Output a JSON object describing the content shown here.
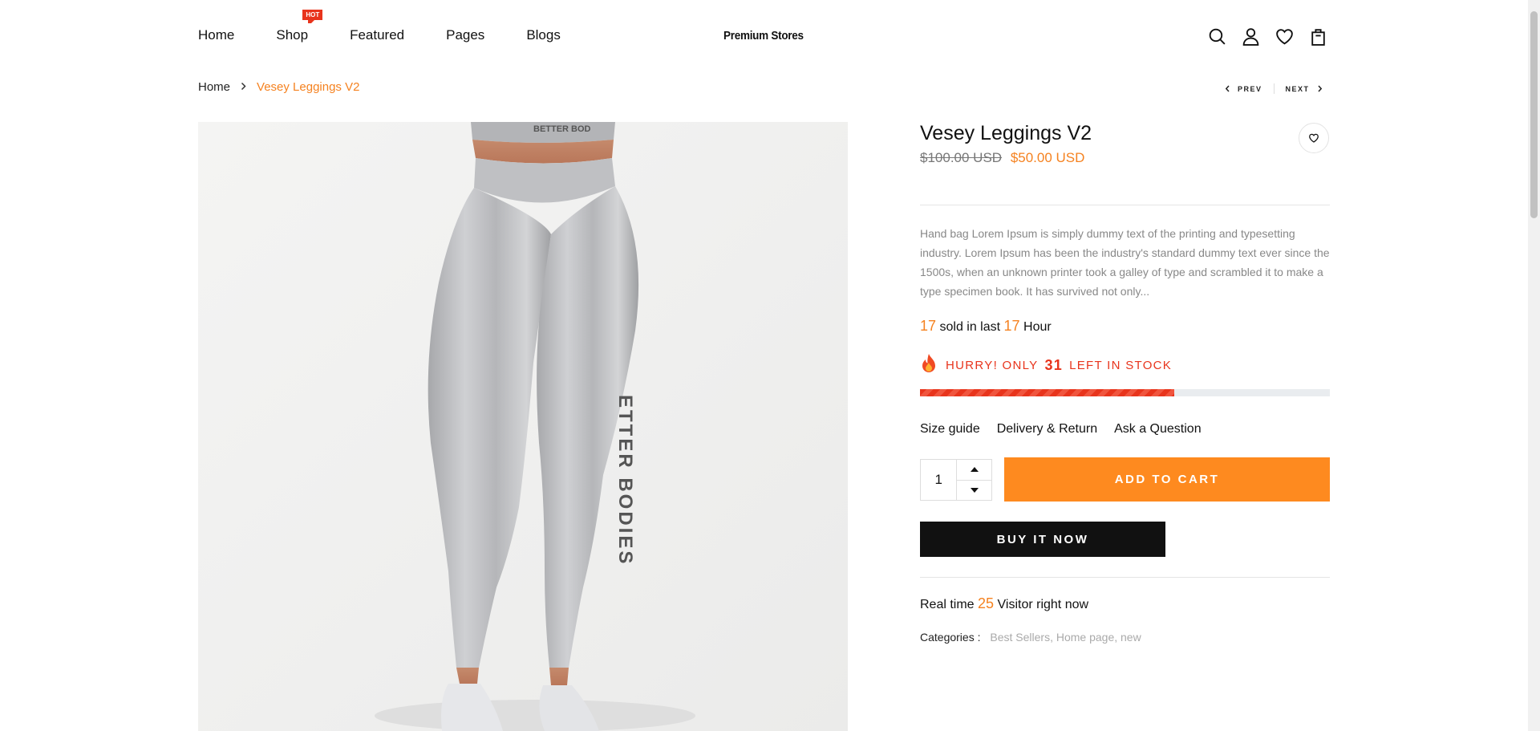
{
  "header": {
    "nav": [
      {
        "label": "Home"
      },
      {
        "label": "Shop",
        "badge": "HOT"
      },
      {
        "label": "Featured"
      },
      {
        "label": "Pages"
      },
      {
        "label": "Blogs"
      }
    ],
    "logo": "Premium Stores",
    "icons": [
      "search-icon",
      "user-icon",
      "heart-icon",
      "bag-icon"
    ]
  },
  "breadcrumb": {
    "home": "Home",
    "current": "Vesey Leggings V2"
  },
  "pager": {
    "prev": "PREV",
    "next": "NEXT"
  },
  "product": {
    "title": "Vesey Leggings V2",
    "old_price": "$100.00 USD",
    "price": "$50.00 USD",
    "description": "Hand bag Lorem Ipsum is simply dummy text of the printing and typesetting industry. Lorem Ipsum has been the industry's standard dummy text ever since the 1500s, when an unknown printer took a galley of type and scrambled it to make a type specimen book. It has survived not only...",
    "sold": {
      "count": "17",
      "text1": "sold in last",
      "hours": "17",
      "text2": "Hour"
    },
    "stock": {
      "prefix": "HURRY! ONLY",
      "count": "31",
      "suffix": "LEFT IN STOCK",
      "fill_fraction": 0.62
    },
    "links": [
      "Size guide",
      "Delivery & Return",
      "Ask a Question"
    ],
    "quantity": "1",
    "add_to_cart": "ADD TO CART",
    "buy_now": "BUY IT NOW",
    "realtime": {
      "prefix": "Real time",
      "count": "25",
      "suffix": "Visitor right now"
    },
    "categories": {
      "label": "Categories :",
      "values": "Best Sellers, Home page, new"
    }
  },
  "colors": {
    "accent": "#f58220",
    "button": "#fe8a1f",
    "danger": "#e8341c",
    "dark": "#111111"
  }
}
